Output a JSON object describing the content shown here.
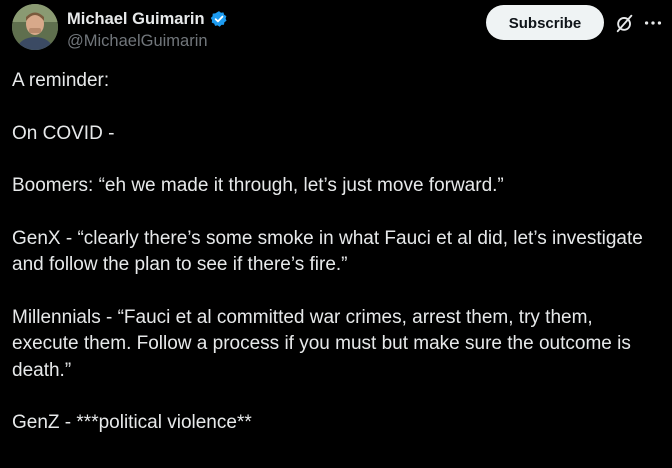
{
  "author": {
    "display_name": "Michael Guimarin",
    "handle": "@MichaelGuimarin"
  },
  "actions": {
    "subscribe_label": "Subscribe"
  },
  "icons": {
    "verified": "verified-badge-icon",
    "grok": "grok-icon",
    "more": "more-options-icon"
  },
  "colors": {
    "background": "#000000",
    "text": "#e7e9ea",
    "muted": "#71767b",
    "verified": "#1d9bf0",
    "button_bg": "#eff3f4"
  },
  "tweet": {
    "paragraphs": [
      "A reminder:",
      "On COVID -",
      "Boomers: “eh we made it through, let’s just move forward.”",
      "GenX - “clearly there’s some smoke in what Fauci et al did, let’s investigate and follow the plan to see if there’s fire.”",
      "Millennials - “Fauci et al committed war crimes, arrest them, try them, execute them. Follow a process if you must but make sure the outcome is death.”",
      "GenZ - ***political violence**"
    ]
  }
}
